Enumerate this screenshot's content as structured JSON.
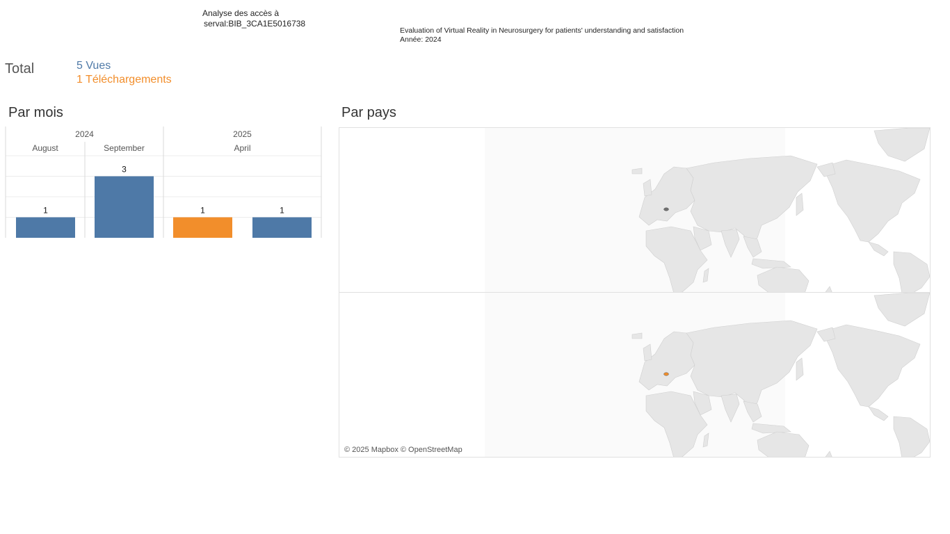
{
  "header": {
    "line1": "Analyse des accès à",
    "line2": "serval:BIB_3CA1E5016738",
    "doc_title": "Evaluation of Virtual Reality in Neurosurgery for patients' understanding and satisfaction",
    "year_line": "Année: 2024"
  },
  "totals": {
    "label": "Total",
    "views": "5 Vues",
    "downloads": "1 Téléchargements"
  },
  "colors": {
    "views": "#4e79a7",
    "downloads": "#f28e2b",
    "land": "#e6e6e6",
    "border": "#cfcfcf"
  },
  "sections": {
    "by_month": "Par mois",
    "by_country": "Par pays"
  },
  "map": {
    "attribution": "© 2025 Mapbox © OpenStreetMap"
  },
  "chart_data": {
    "type": "bar",
    "title": "Par mois",
    "years": [
      {
        "label": "2024",
        "months": [
          "August",
          "September"
        ]
      },
      {
        "label": "2025",
        "months": [
          "April"
        ]
      }
    ],
    "bars": [
      {
        "year": "2024",
        "month": "August",
        "metric": "Vues",
        "value": 1
      },
      {
        "year": "2024",
        "month": "September",
        "metric": "Vues",
        "value": 3
      },
      {
        "year": "2025",
        "month": "April",
        "metric": "Téléchargements",
        "value": 1
      },
      {
        "year": "2025",
        "month": "April",
        "metric": "Vues",
        "value": 1
      }
    ],
    "ylim": [
      0,
      4
    ],
    "grid": true
  }
}
